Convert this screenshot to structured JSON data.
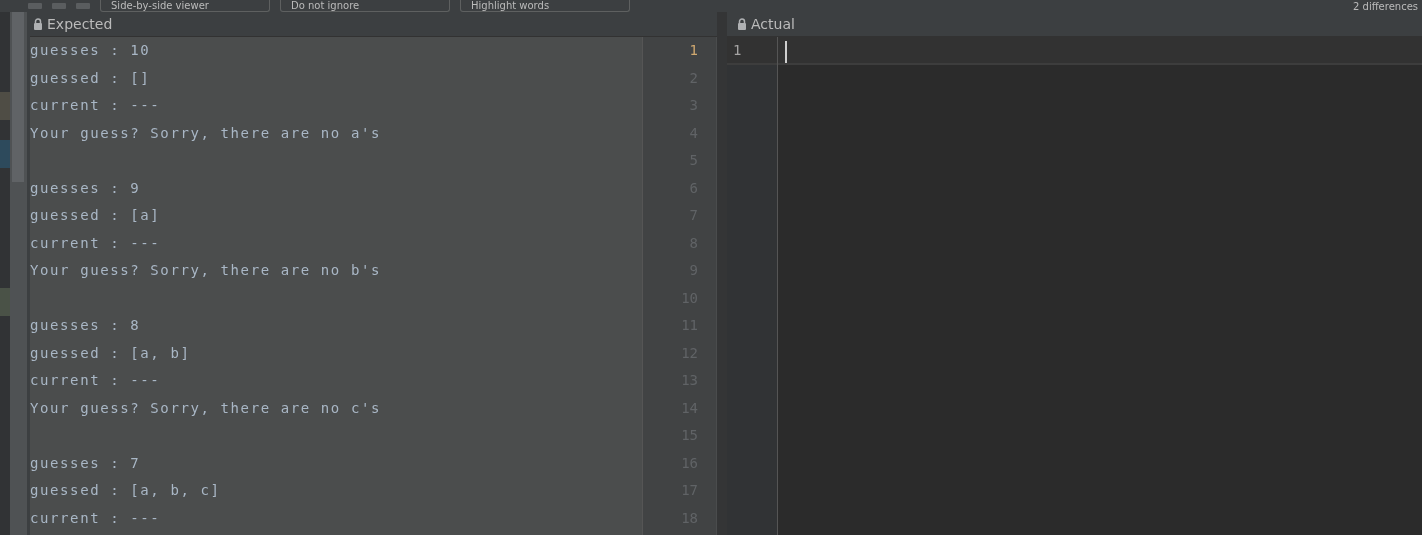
{
  "toolbar": {
    "items": [
      {
        "kind": "combo",
        "label": "Side-by-side viewer"
      },
      {
        "kind": "combo",
        "label": "Do not ignore"
      },
      {
        "kind": "combo",
        "label": "Highlight words"
      }
    ],
    "status": "2 differences"
  },
  "expected": {
    "title": "Expected",
    "lines": [
      {
        "number": "1",
        "text": "guesses : 10",
        "current": true
      },
      {
        "number": "2",
        "text": "guessed : []",
        "current": false
      },
      {
        "number": "3",
        "text": "current : ---",
        "current": false
      },
      {
        "number": "4",
        "text": "Your guess? Sorry, there are no a's",
        "current": false
      },
      {
        "number": "5",
        "current": false
      },
      {
        "number": "6",
        "text": "guesses : 9",
        "current": false
      },
      {
        "number": "7",
        "text": "guessed : [a]",
        "current": false
      },
      {
        "number": "8",
        "text": "current : ---",
        "current": false
      },
      {
        "number": "9",
        "text": "Your guess? Sorry, there are no b's",
        "current": false
      },
      {
        "number": "10",
        "current": false
      },
      {
        "number": "11",
        "text": "guesses : 8",
        "current": false
      },
      {
        "number": "12",
        "text": "guessed : [a, b]",
        "current": false
      },
      {
        "number": "13",
        "text": "current : ---",
        "current": false
      },
      {
        "number": "14",
        "text": "Your guess? Sorry, there are no c's",
        "current": false
      },
      {
        "number": "15",
        "current": false
      },
      {
        "number": "16",
        "text": "guesses : 7",
        "current": false
      },
      {
        "number": "17",
        "text": "guessed : [a, b, c]",
        "current": false
      },
      {
        "number": "18",
        "text": "current : ---",
        "current": false
      }
    ]
  },
  "actual": {
    "title": "Actual",
    "lines": [
      {
        "number": "1",
        "current": true
      }
    ]
  }
}
